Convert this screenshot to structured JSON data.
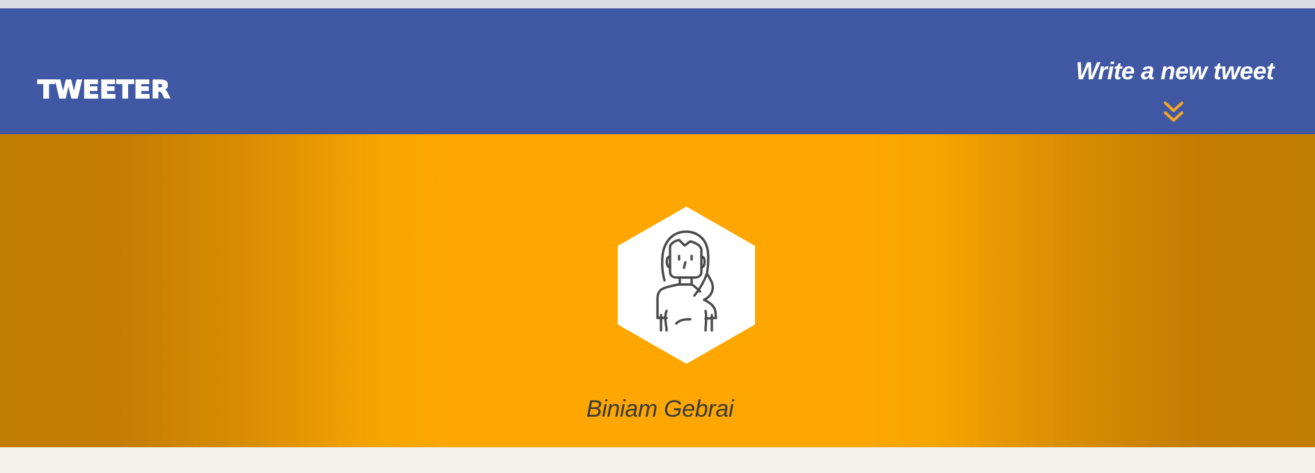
{
  "header": {
    "logo_text": "TWEETER",
    "compose_label": "Write a new tweet",
    "compose_icon": "double-chevron-down-icon"
  },
  "profile": {
    "name": "Biniam Gebrai",
    "avatar_icon": "woman-avatar-icon"
  },
  "colors": {
    "nav_background": "#4058a3",
    "banner_center": "#ffa700",
    "banner_edge": "#c17c02",
    "accent_arrow": "#f5a623",
    "page_background": "#f4f1ec",
    "name_text": "#3a3a3a"
  }
}
